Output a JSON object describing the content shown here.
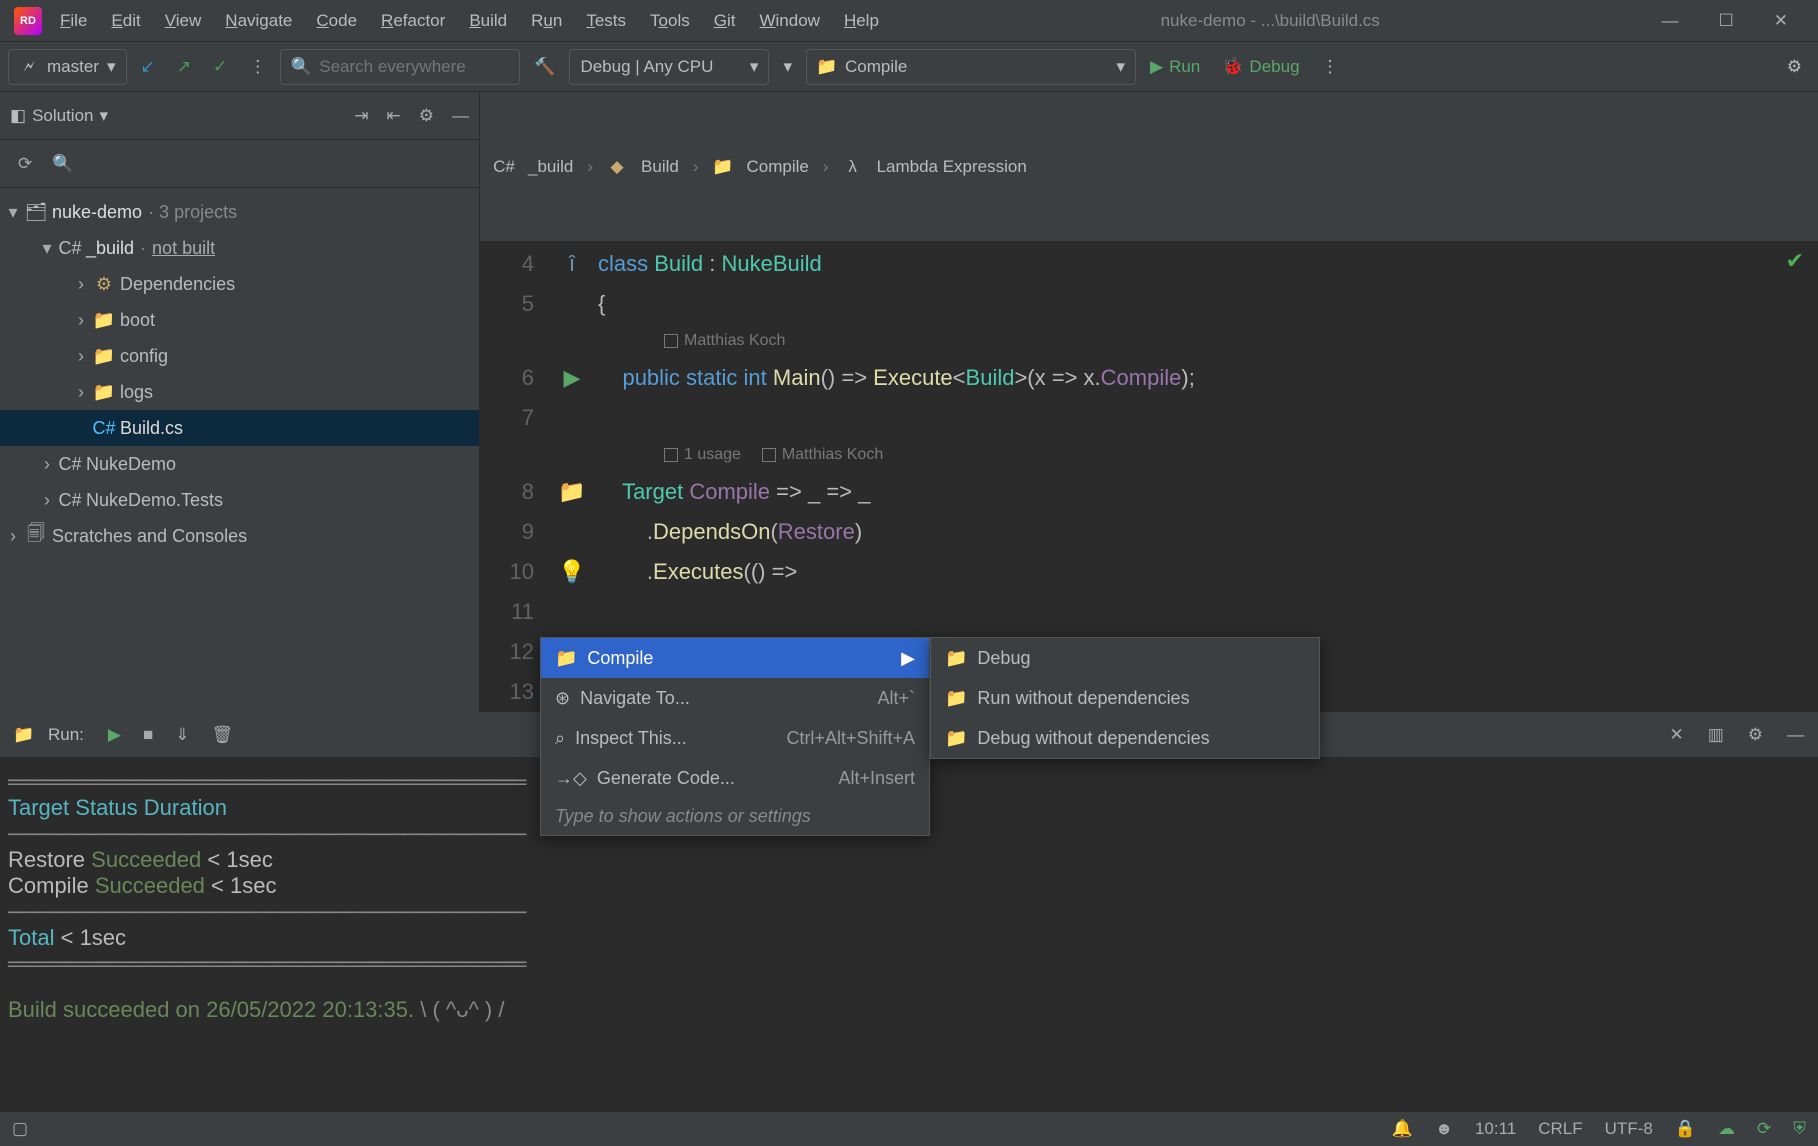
{
  "titlebar": {
    "title": "nuke-demo - ...\\build\\Build.cs",
    "menu": [
      "File",
      "Edit",
      "View",
      "Navigate",
      "Code",
      "Refactor",
      "Build",
      "Run",
      "Tests",
      "Tools",
      "Git",
      "Window",
      "Help"
    ]
  },
  "toolbar": {
    "branch": "master",
    "searchPlaceholder": "Search everywhere",
    "config": "Debug | Any CPU",
    "target": "Compile",
    "run": "Run",
    "debug": "Debug"
  },
  "sidebar": {
    "title": "Solution",
    "root": {
      "name": "nuke-demo",
      "suffix": " · 3 projects"
    },
    "build": {
      "name": "_build",
      "suffix": " · ",
      "status": "not built"
    },
    "folders": [
      "Dependencies",
      "boot",
      "config",
      "logs"
    ],
    "file": "Build.cs",
    "proj1": "NukeDemo",
    "proj2": "NukeDemo.Tests",
    "scratches": "Scratches and Consoles"
  },
  "breadcrumb": {
    "a": "_build",
    "b": "Build",
    "c": "Compile",
    "d": "Lambda Expression"
  },
  "editor": {
    "lineNums": [
      "4",
      "5",
      "",
      "6",
      "7",
      "",
      "8",
      "9",
      "10",
      "11",
      "12",
      "13"
    ],
    "author": "Matthias Koch",
    "usage": "1 usage"
  },
  "ctx1": {
    "compile": "Compile",
    "nav": "Navigate To...",
    "navKey": "Alt+`",
    "inspect": "Inspect This...",
    "inspectKey": "Ctrl+Alt+Shift+A",
    "gen": "Generate Code...",
    "genKey": "Alt+Insert",
    "hint": "Type to show actions or settings"
  },
  "ctx2": {
    "debug": "Debug",
    "runNo": "Run without dependencies",
    "debugNo": "Debug without dependencies"
  },
  "run": {
    "title": "Run:",
    "hdr": {
      "t": "Target",
      "s": "Status",
      "d": "Duration"
    },
    "rows": [
      {
        "t": "Restore",
        "s": "Succeeded",
        "d": "< 1sec"
      },
      {
        "t": "Compile",
        "s": "Succeeded",
        "d": "< 1sec"
      }
    ],
    "total": {
      "t": "Total",
      "d": "< 1sec"
    },
    "msg": "Build succeeded on 26/05/2022 20:13:35.",
    "face": "\\  ( ^ᴗ^ )  /"
  },
  "status": {
    "time": "10:11",
    "eol": "CRLF",
    "enc": "UTF-8"
  }
}
